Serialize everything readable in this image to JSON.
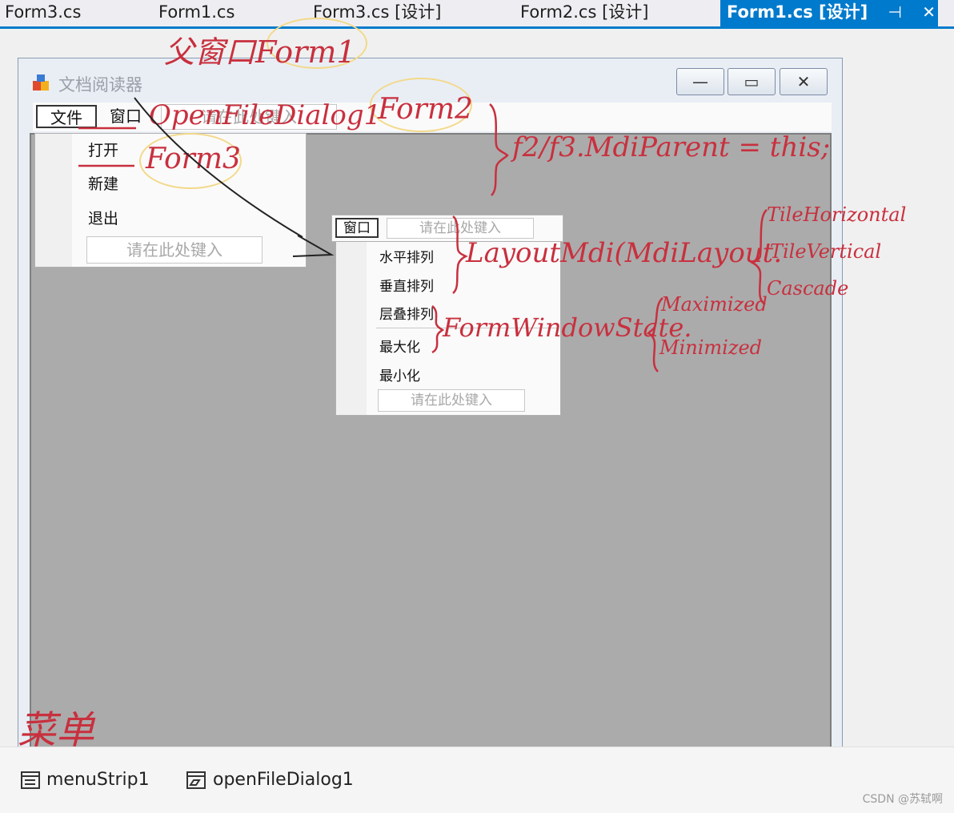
{
  "tabs": [
    {
      "label": "Form3.cs"
    },
    {
      "label": "Form1.cs"
    },
    {
      "label": "Form3.cs [设计]"
    },
    {
      "label": "Form2.cs [设计]"
    },
    {
      "label": "Form1.cs [设计]",
      "pin": "⊣",
      "close": "✕",
      "active": true
    }
  ],
  "form": {
    "title": "文档阅读器",
    "minimize": "—",
    "maximize": "▭",
    "close": "✕"
  },
  "menubar": {
    "items": [
      "文件",
      "窗口"
    ],
    "placeholder": "请在此处键入"
  },
  "file_menu": {
    "items": [
      "打开",
      "新建",
      "退出"
    ],
    "placeholder": "请在此处键入"
  },
  "child_form": {
    "menubar_item": "窗口",
    "placeholder": "请在此处键入",
    "layout_items": [
      "水平排列",
      "垂直排列",
      "层叠排列"
    ],
    "state_items": [
      "最大化",
      "最小化"
    ],
    "dropdown_placeholder": "请在此处键入"
  },
  "tray": {
    "items": [
      "menuStrip1",
      "openFileDialog1"
    ]
  },
  "annotations": {
    "parent": "父窗口Form1",
    "open_dialog": "OpenFileDialog1",
    "form2": "Form2",
    "form3": "Form3",
    "mdi_parent": "f2/f3.MdiParent = this;",
    "layout_mdi": "LayoutMdi(MdiLayout.",
    "tile_horizontal": "TileHorizontal",
    "tile_vertical": "TileVertical",
    "cascade": "Cascade",
    "window_state": "FormWindowState.",
    "maximized": "Maximized",
    "minimized": "Minimized",
    "menu": "菜单"
  },
  "watermark": "CSDN @苏轼啊",
  "colors": {
    "accent": "#007acc",
    "annotation": "#c8303e",
    "highlight_circle": "#f3d98a",
    "mdi_background": "#ababab"
  }
}
